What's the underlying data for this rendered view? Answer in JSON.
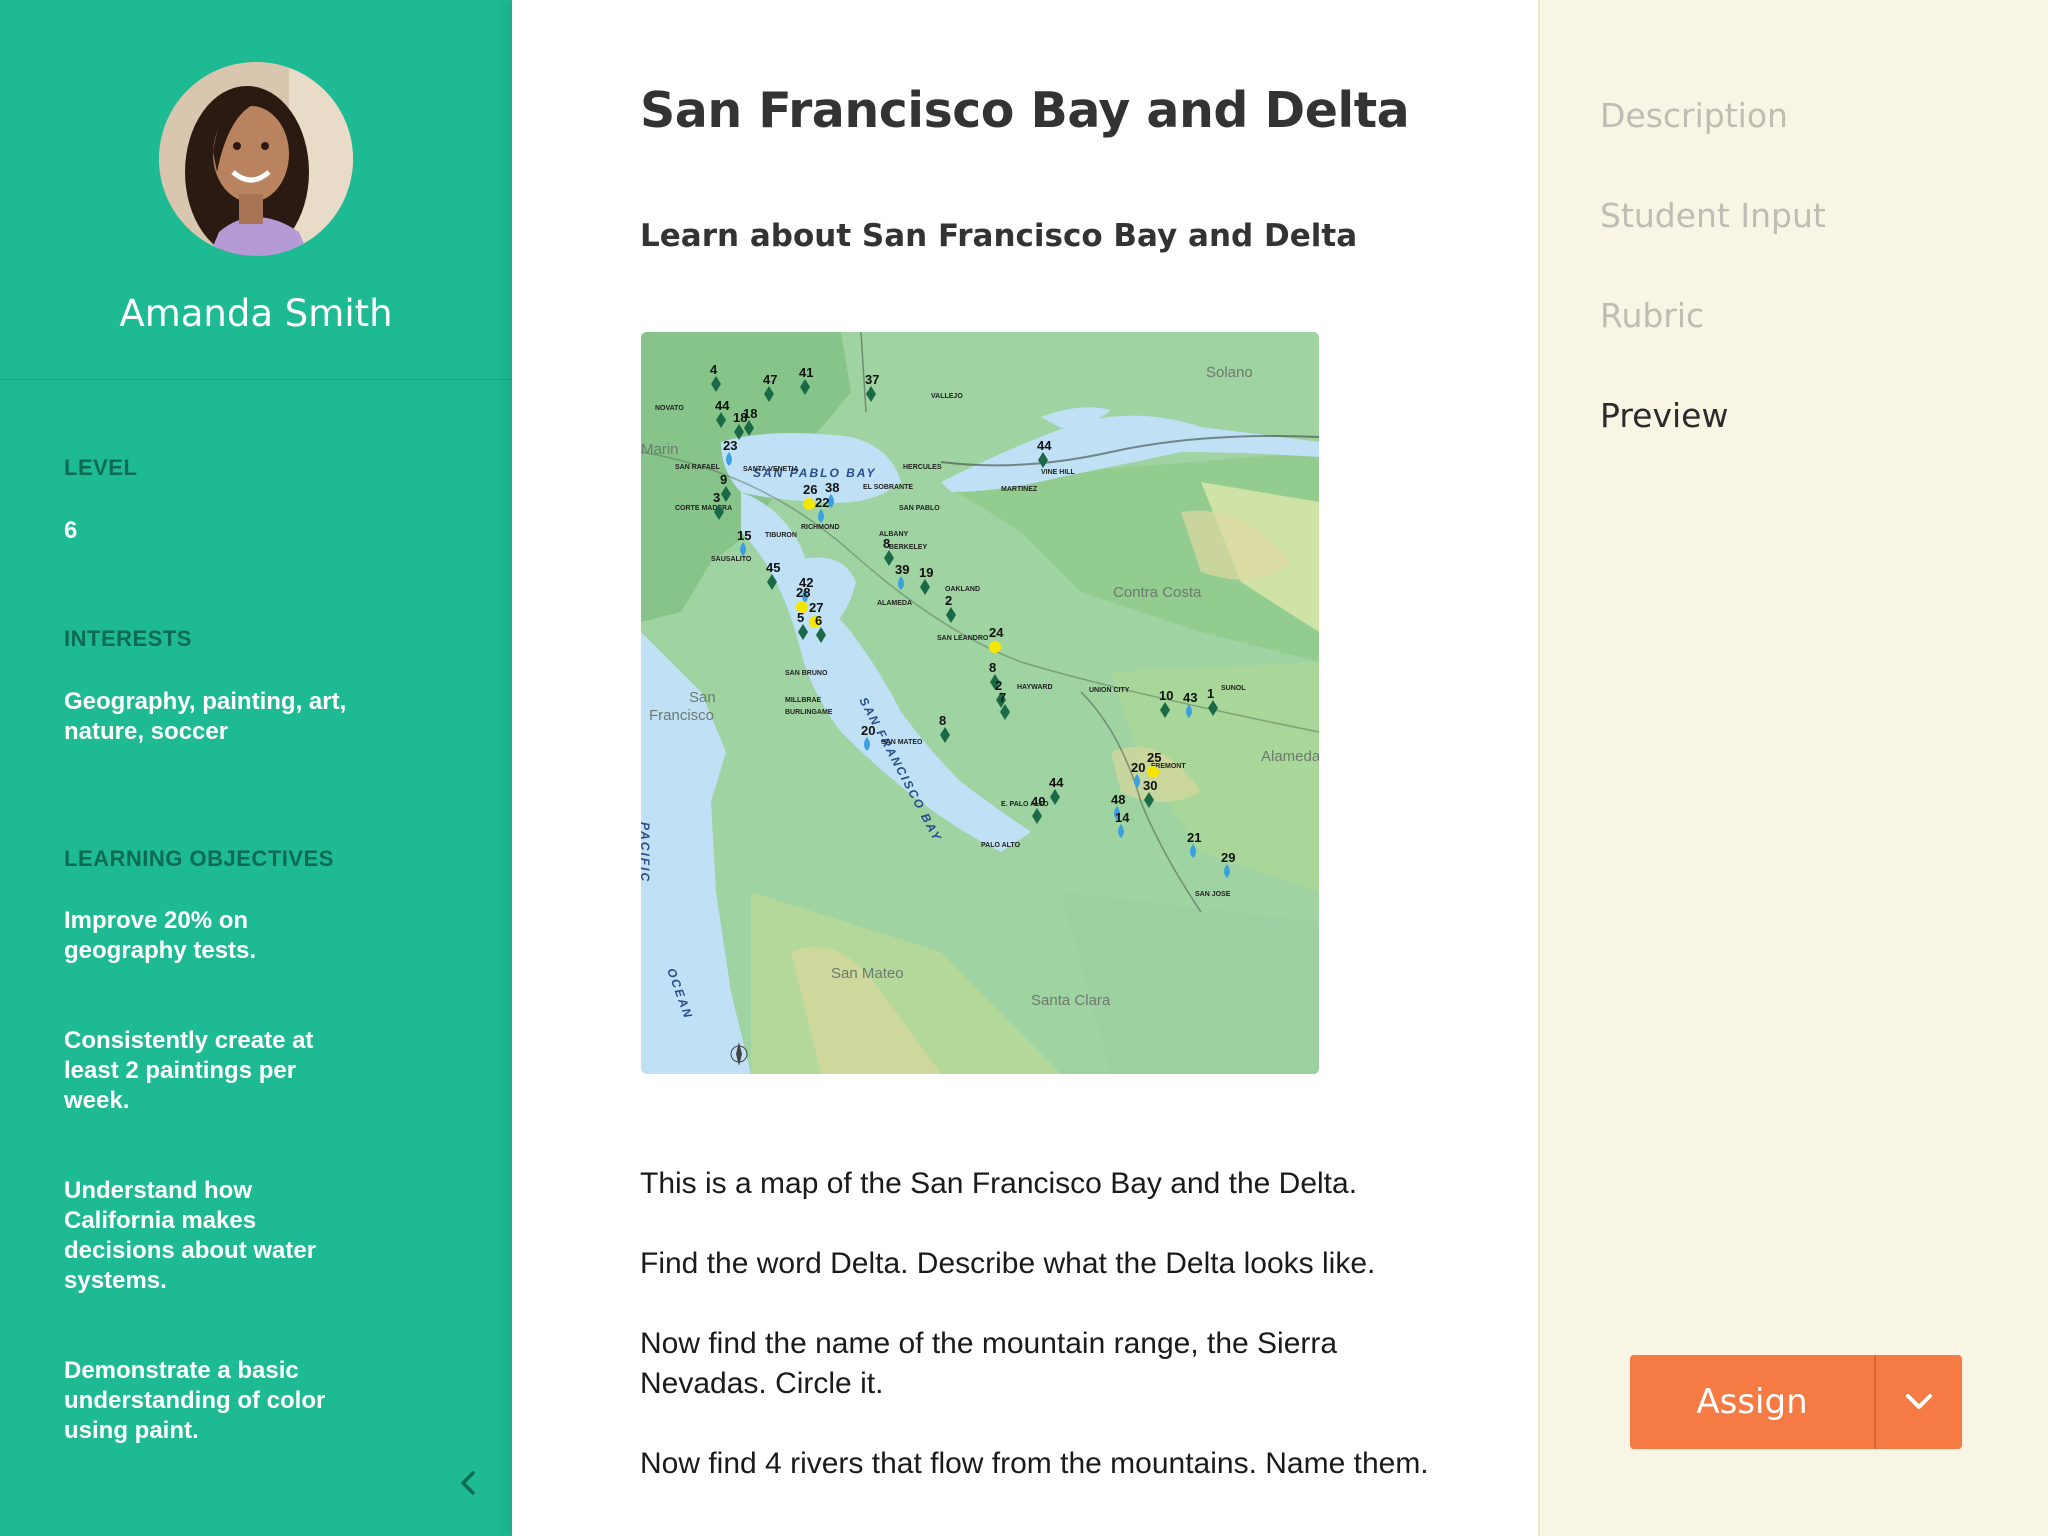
{
  "student": {
    "name": "Amanda Smith",
    "level_label": "LEVEL",
    "level_value": "6",
    "interests_label": "INTERESTS",
    "interests_value": "Geography, painting, art, nature, soccer",
    "objectives_label": "LEARNING OBJECTIVES",
    "objectives": [
      "Improve 20% on geography tests.",
      "Consistently create at least 2 paintings per week.",
      "Understand how California makes decisions about water systems.",
      "Demonstrate a basic understanding of color using paint."
    ]
  },
  "lesson": {
    "title": "San Francisco Bay and Delta",
    "subtitle": "Learn about San Francisco Bay and Delta",
    "paragraphs": [
      "This is a map of the San Francisco Bay and the Delta.",
      "Find the word Delta. Describe what the Delta looks like.",
      "Now find the name of the mountain range, the Sierra Nevadas. Circle it.",
      "Now find 4 rivers that flow from the mountains. Name them."
    ]
  },
  "map": {
    "regions": [
      "Solano",
      "Marin",
      "Contra Costa",
      "San Francisco",
      "Alameda",
      "San Mateo",
      "Santa Clara"
    ],
    "water_labels": [
      "SAN PABLO BAY",
      "SAN FRANCISCO BAY",
      "PACIFIC",
      "OCEAN"
    ],
    "towns": [
      "NOVATO",
      "VALLEJO",
      "SAN RAFAEL",
      "HERCULES",
      "VINE HILL",
      "MARTINEZ",
      "EL SOBRANTE",
      "SAN PABLO",
      "CORTE MADERA",
      "RICHMOND",
      "TIBURON",
      "ALBANY",
      "BERKELEY",
      "SAUSALITO",
      "OAKLAND",
      "ALAMEDA",
      "SAN LEANDRO",
      "HAYWARD",
      "UNION CITY",
      "SUNOL",
      "SAN BRUNO",
      "MILLBRAE",
      "BURLINGAME",
      "SAN MATEO",
      "FREMONT",
      "E. PALO ALTO",
      "PALO ALTO",
      "SAN JOSE",
      "SANTA VENETIA"
    ],
    "site_numbers": [
      "4",
      "47",
      "41",
      "37",
      "44",
      "18",
      "23",
      "9",
      "3",
      "15",
      "26",
      "38",
      "22",
      "8",
      "45",
      "42",
      "39",
      "19",
      "2",
      "28",
      "27",
      "5",
      "6",
      "24",
      "8",
      "2",
      "7",
      "10",
      "43",
      "1",
      "20",
      "8",
      "20",
      "25",
      "44",
      "30",
      "40",
      "48",
      "14",
      "21",
      "29",
      "44",
      "18"
    ]
  },
  "nav": {
    "items": [
      "Description",
      "Student Input",
      "Rubric",
      "Preview"
    ],
    "active": "Preview"
  },
  "actions": {
    "assign_label": "Assign"
  },
  "colors": {
    "sidebar": "#1dba94",
    "label_dark": "#0d6b53",
    "right_panel": "#f8f5e4",
    "assign": "#f57a43"
  }
}
